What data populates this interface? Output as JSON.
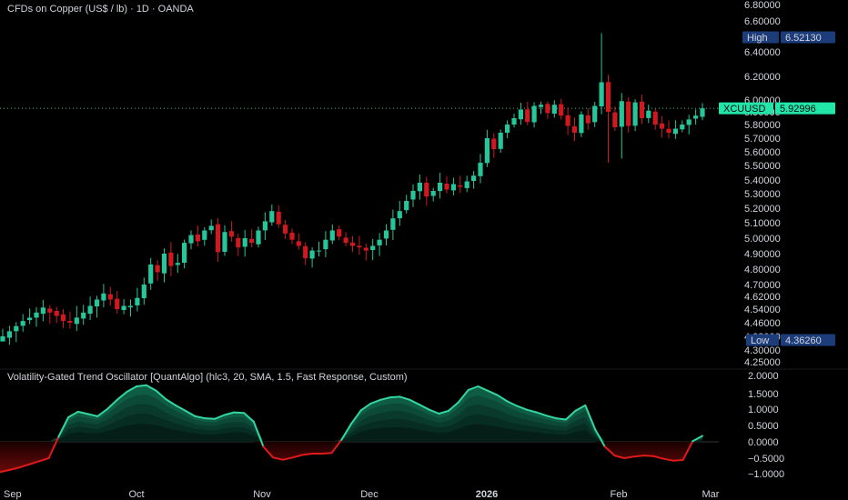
{
  "header": {
    "symbol_title": "CFDs on Copper (US$ / lb) · 1D · OANDA"
  },
  "colors": {
    "up": "#26c69a",
    "down": "#d0181f",
    "badge_blue": "#1c3c7a",
    "ticker_green": "#22e5a8",
    "oscillator_green": "#33d6a0",
    "oscillator_red": "#e01a1a"
  },
  "badges": {
    "high_label": "High",
    "high_value": "6.52130",
    "low_label": "Low",
    "low_value": "4.36260",
    "ticker_label": "XCUUSD",
    "ticker_value": "5.92996"
  },
  "chart_data": [
    {
      "type": "candlestick",
      "title": "CFDs on Copper (US$ / lb) · 1D · OANDA",
      "ylim": [
        4.22,
        6.82
      ],
      "y_ticks": [
        "6.80000",
        "6.60000",
        "6.40000",
        "6.20000",
        "6.00000",
        "5.90000",
        "5.80000",
        "5.70000",
        "5.60000",
        "5.50000",
        "5.40000",
        "5.30000",
        "5.20000",
        "5.10000",
        "5.00000",
        "4.90000",
        "4.80000",
        "4.70000",
        "4.62000",
        "4.54000",
        "4.46000",
        "4.38000",
        "4.30000",
        "4.25000"
      ],
      "high": 6.5213,
      "low": 4.3626,
      "last": 5.92996,
      "close_series": [
        4.38,
        4.41,
        4.44,
        4.47,
        4.49,
        4.52,
        4.55,
        4.52,
        4.5,
        4.47,
        4.46,
        4.49,
        4.52,
        4.56,
        4.6,
        4.64,
        4.6,
        4.54,
        4.56,
        4.56,
        4.61,
        4.7,
        4.83,
        4.78,
        4.9,
        4.82,
        4.84,
        4.97,
        5.02,
        4.98,
        5.05,
        5.08,
        4.91,
        5.04,
        5.01,
        4.94,
        5.0,
        4.97,
        5.05,
        5.11,
        5.18,
        5.09,
        5.03,
        4.99,
        4.95,
        4.87,
        4.92,
        4.92,
        4.99,
        5.05,
        5.01,
        4.97,
        4.95,
        4.94,
        4.92,
        4.95,
        4.99,
        5.05,
        5.13,
        5.18,
        5.25,
        5.32,
        5.38,
        5.28,
        5.32,
        5.38,
        5.33,
        5.37,
        5.35,
        5.39,
        5.43,
        5.52,
        5.7,
        5.62,
        5.74,
        5.8,
        5.85,
        5.92,
        5.82,
        5.95,
        5.96,
        5.89,
        5.96,
        5.87,
        5.79,
        5.74,
        5.88,
        5.81,
        5.95,
        6.15,
        5.9,
        5.78,
        5.99,
        5.79,
        5.98,
        5.85,
        5.91,
        5.8,
        5.77,
        5.74,
        5.77,
        5.8,
        5.84,
        5.87,
        5.93
      ]
    },
    {
      "type": "area",
      "title": "Volatility-Gated Trend Oscillator [QuantAlgo] (hlc3, 20, SMA, 1.5, Fast Response, Custom)",
      "ylim": [
        -1.2,
        2.05
      ],
      "y_ticks": [
        "2.0000",
        "1.5000",
        "1.0000",
        "0.5000",
        "0.0000",
        "−0.5000",
        "−1.0000"
      ],
      "values": [
        -0.95,
        -0.88,
        -0.8,
        -0.7,
        -0.6,
        -0.5,
        0.15,
        0.75,
        0.92,
        0.85,
        0.78,
        1.0,
        1.3,
        1.55,
        1.7,
        1.73,
        1.58,
        1.32,
        1.12,
        0.95,
        0.78,
        0.72,
        0.7,
        0.82,
        0.9,
        0.88,
        0.62,
        -0.15,
        -0.48,
        -0.55,
        -0.48,
        -0.4,
        -0.36,
        -0.36,
        -0.34,
        0.06,
        0.55,
        0.96,
        1.18,
        1.3,
        1.38,
        1.4,
        1.3,
        1.14,
        0.98,
        0.86,
        0.95,
        1.22,
        1.6,
        1.7,
        1.58,
        1.45,
        1.25,
        1.1,
        0.98,
        0.9,
        0.8,
        0.72,
        0.68,
        0.95,
        1.12,
        0.38,
        -0.15,
        -0.42,
        -0.5,
        -0.45,
        -0.42,
        -0.44,
        -0.52,
        -0.58,
        -0.56,
        0.02,
        0.18
      ]
    }
  ],
  "x_axis": {
    "labels": [
      "Sep",
      "Oct",
      "Nov",
      "Dec",
      "2026",
      "Feb",
      "Mar"
    ],
    "bold_label": "2026"
  }
}
